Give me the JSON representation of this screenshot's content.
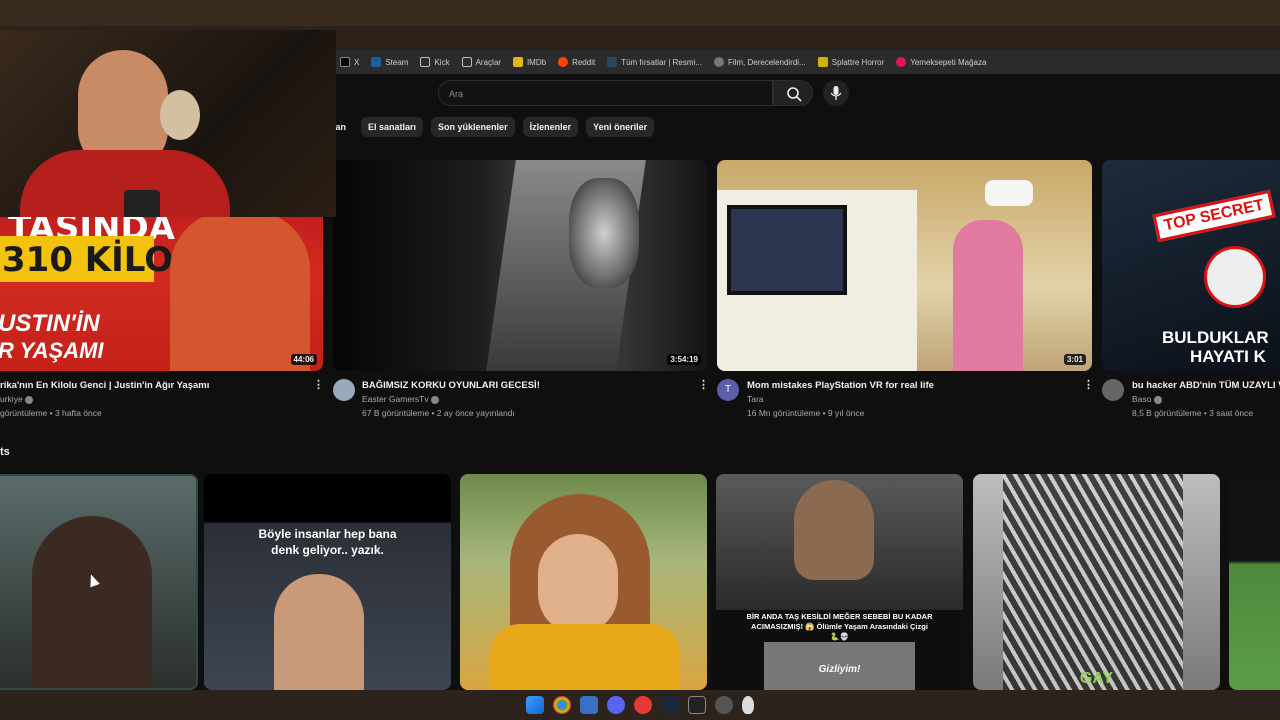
{
  "bookmarks": [
    "X",
    "Steam",
    "Kick",
    "Araçlar",
    "IMDb",
    "Reddit",
    "Tüm fırsatlar | Resmi...",
    "Film, Derecelendirdi...",
    "Splattre Horror",
    "Yemeksepeti Mağaza"
  ],
  "search": {
    "placeholder": "Ara"
  },
  "chips": [
    "lan",
    "El sanatları",
    "Son yüklenenler",
    "İzlenenler",
    "Yeni öneriler"
  ],
  "videos": [
    {
      "title": "rika'nın En Kilolu Genci | Justin'in Ağır Yaşamı",
      "channel": "urkiye",
      "meta": "görüntüleme • 3 hafta önce",
      "duration": "44:06",
      "thumb_top": "TAŞINDA",
      "thumb_mid": "310 KİLO",
      "thumb_b1": "USTIN'İN",
      "thumb_b2": "R YAŞAMI"
    },
    {
      "title": "BAĞIMSIZ KORKU OYUNLARI GECESİ!",
      "channel": "Easter GamersTv",
      "meta": "67 B görüntüleme • 2 ay önce yayınlandı",
      "duration": "3:54:19"
    },
    {
      "title": "Mom mistakes PlayStation VR for real life",
      "channel": "Tara",
      "meta": "16 Mn görüntüleme • 9 yıl önce",
      "duration": "3:01",
      "avatar_letter": "T"
    },
    {
      "title": "bu hacker ABD'nin TÜM UZAYLI V",
      "channel": "Baso",
      "meta": "8,5 B görüntüleme • 3 saat önce",
      "thumb_badge": "TOP SECRET",
      "thumb_b1": "BULDUKLAR",
      "thumb_b2": "HAYATI K"
    }
  ],
  "shorts_heading": "ts",
  "shorts": [
    {
      "caption": ""
    },
    {
      "caption": "Böyle insanlar hep bana denk geliyor.. yazık."
    },
    {
      "caption": ""
    },
    {
      "caption": "BİR ANDA TAŞ KESİLDİ MEĞER SEBEBİ BU KADAR ACIMASIZMIŞ! 😱 Ölümle Yaşam Arasındaki Çizgi 🐍💀",
      "sub": "Gizliyim!"
    },
    {
      "caption": "GAY"
    }
  ],
  "colors": {
    "accent_red": "#cc0000",
    "chip_bg": "#272727",
    "page_bg": "#0f0f0f"
  }
}
